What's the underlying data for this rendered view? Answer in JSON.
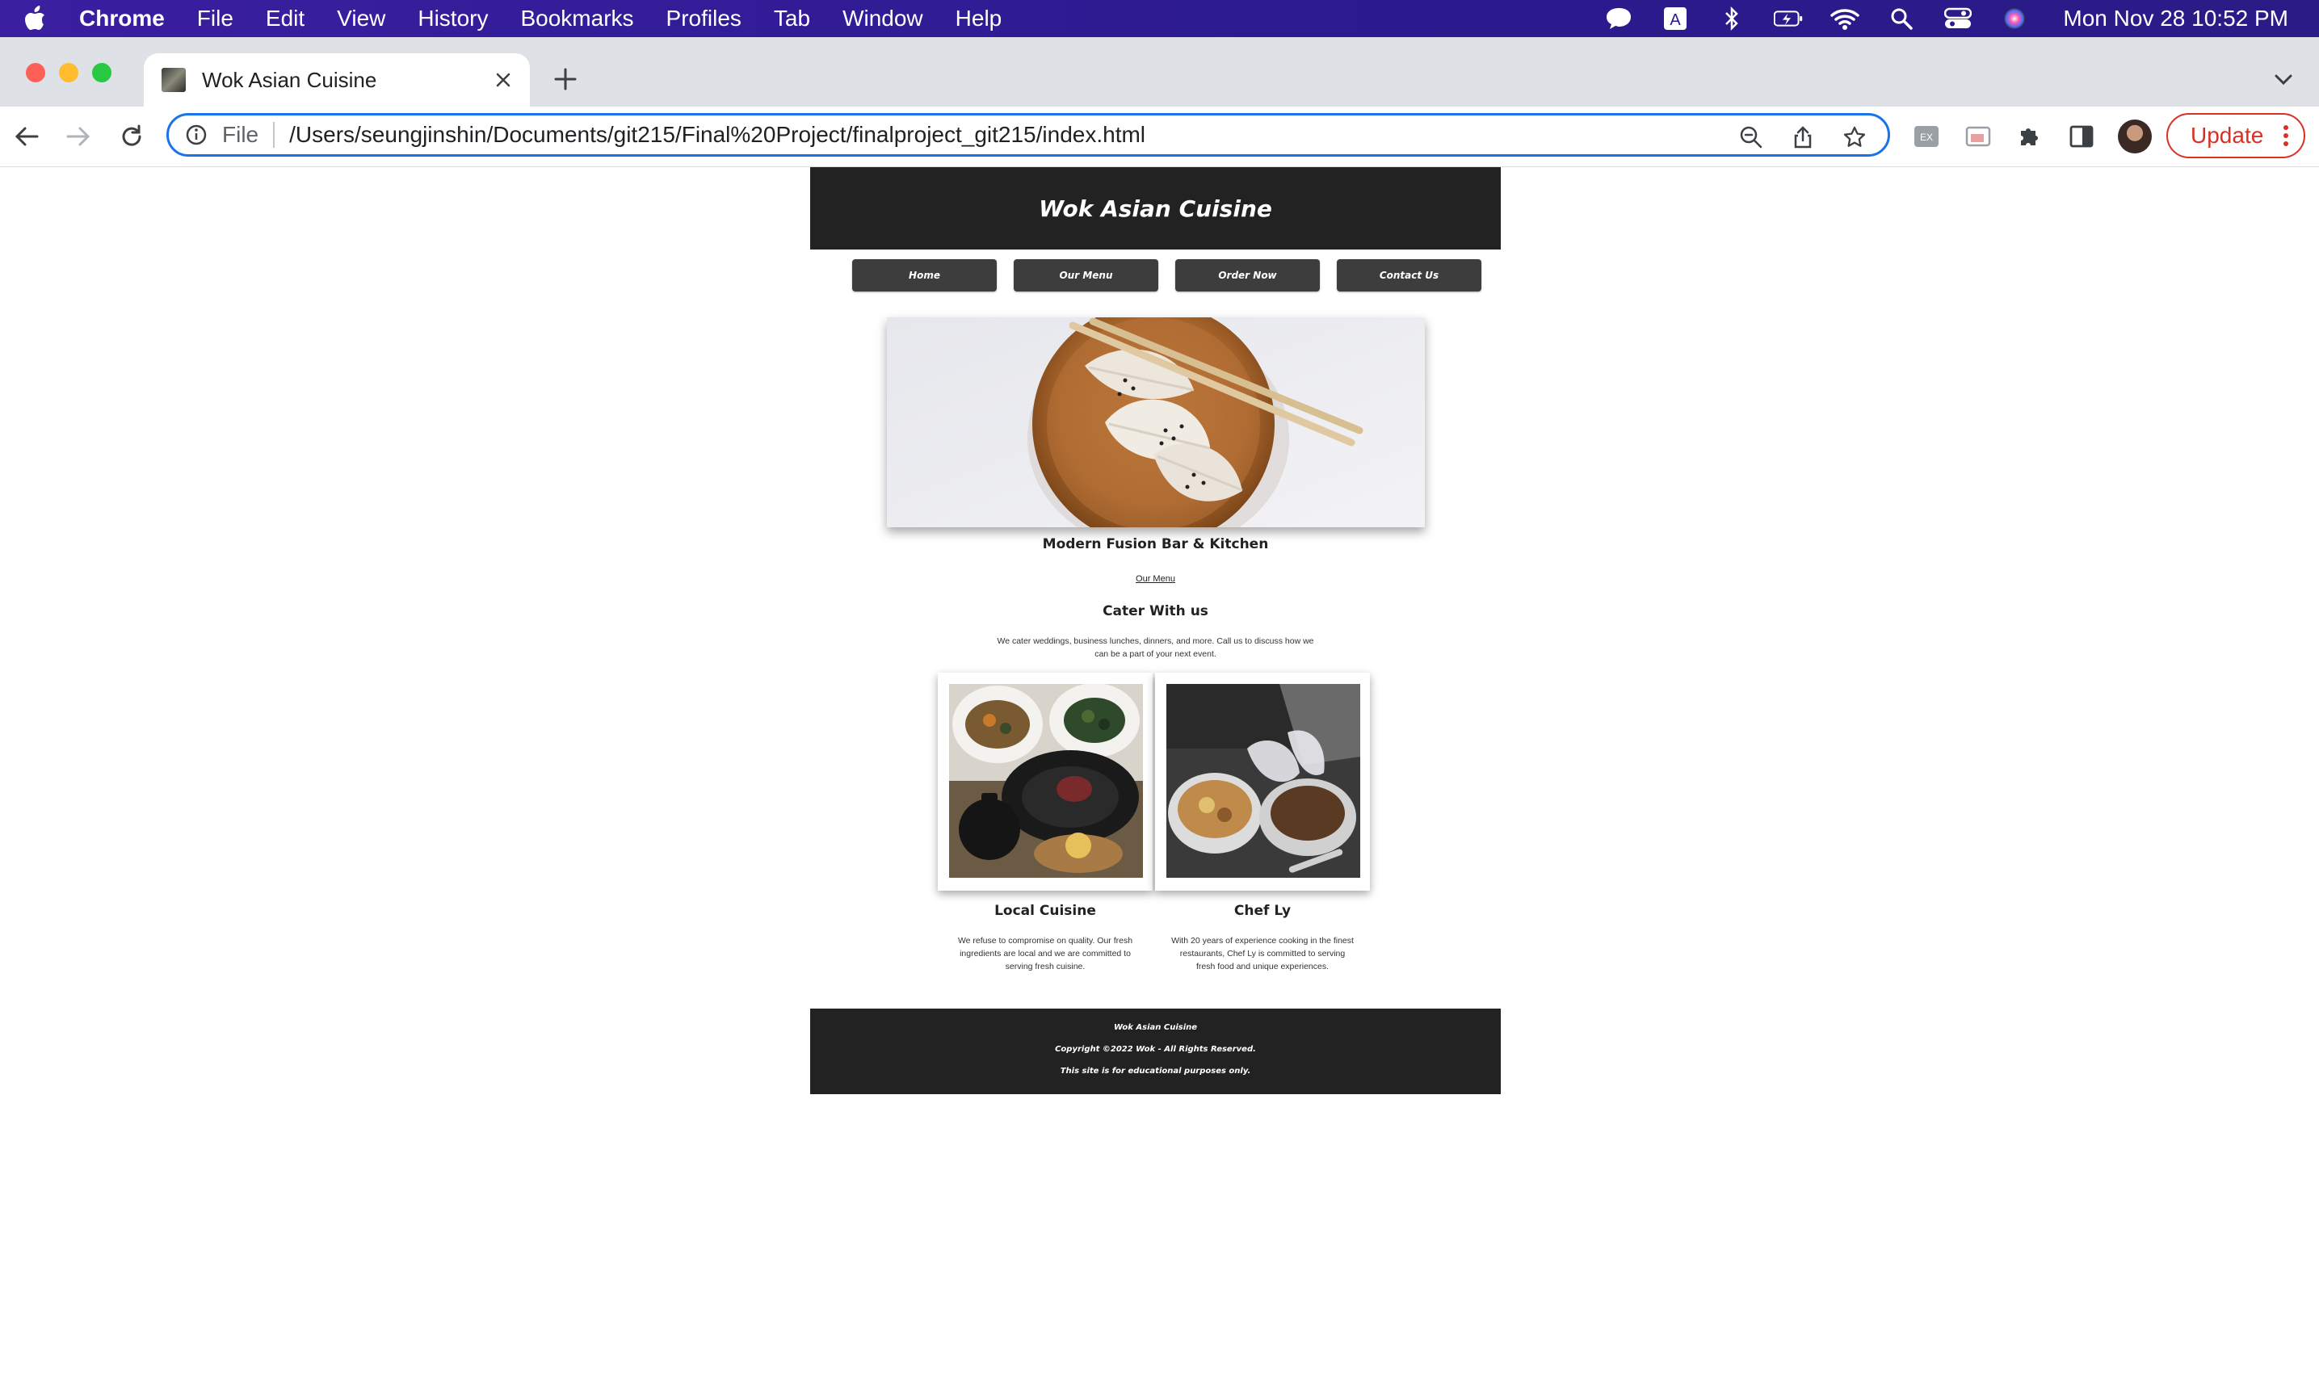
{
  "menubar": {
    "app_name": "Chrome",
    "items": [
      "File",
      "Edit",
      "View",
      "History",
      "Bookmarks",
      "Profiles",
      "Tab",
      "Window",
      "Help"
    ],
    "clock": "Mon Nov 28  10:52 PM",
    "status_icons": [
      "messages-icon",
      "input-source-icon",
      "bluetooth-icon",
      "battery-icon",
      "wifi-icon",
      "spotlight-icon",
      "control-center-icon",
      "siri-icon"
    ]
  },
  "browser": {
    "tab_title": "Wok Asian Cuisine",
    "url_scheme": "File",
    "url": "/Users/seungjinshin/Documents/git215/Final%20Project/finalproject_git215/index.html",
    "update_label": "Update",
    "accent_color": "#1a73e8",
    "update_color": "#d93025"
  },
  "site": {
    "title": "Wok Asian Cuisine",
    "nav": [
      "Home",
      "Our Menu",
      "Order Now",
      "Contact Us"
    ],
    "tagline": "Modern Fusion Bar & Kitchen",
    "menu_link": "Our Menu",
    "cater_heading": "Cater With us",
    "cater_text": "We cater weddings, business lunches, dinners, and more. Call us to discuss how we can be a part of your next event.",
    "cards": [
      {
        "title": "Local Cuisine",
        "text": "We refuse to compromise on quality. Our fresh ingredients are local and we are committed to serving fresh cuisine."
      },
      {
        "title": "Chef Ly",
        "text": "With 20 years of experience cooking in the finest restaurants, Chef Ly is committed to serving fresh food and unique experiences."
      }
    ],
    "footer": {
      "line1": "Wok Asian Cuisine",
      "line2": "Copyright ©2022 Wok - All Rights Reserved.",
      "line3": "This site is for educational purposes only."
    },
    "header_color": "#222222"
  }
}
